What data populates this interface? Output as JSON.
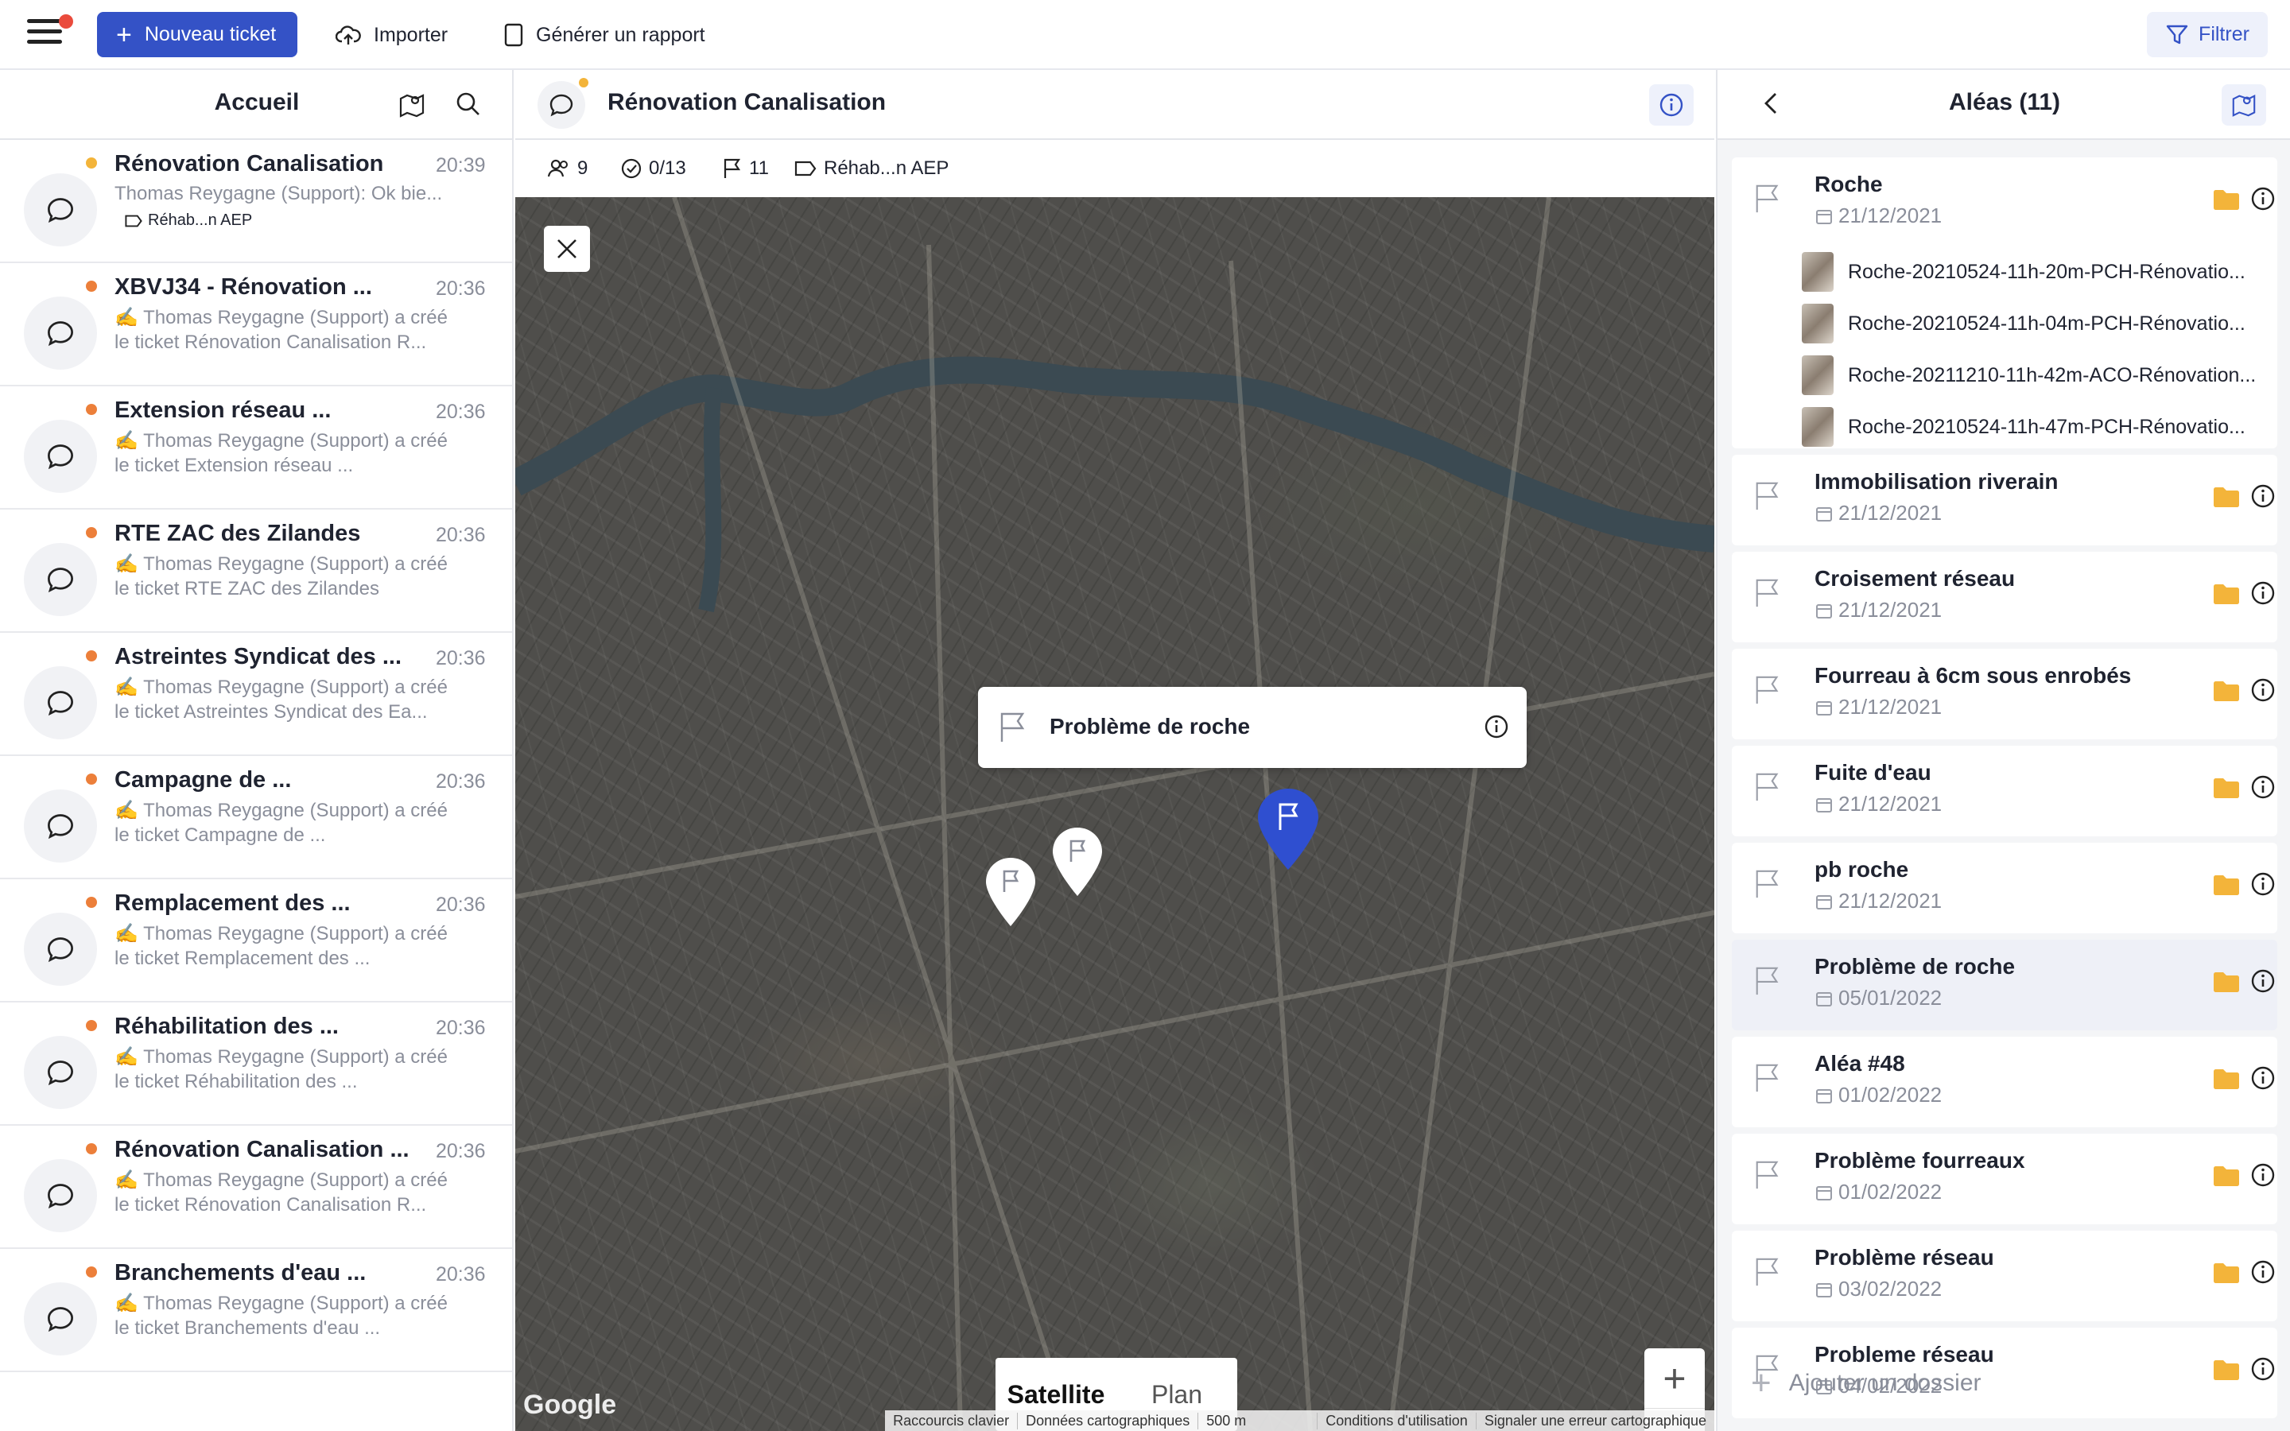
{
  "toolbar": {
    "new_ticket": "Nouveau ticket",
    "import": "Importer",
    "report": "Générer un rapport",
    "filter": "Filtrer"
  },
  "left": {
    "title": "Accueil",
    "tickets": [
      {
        "title": "Rénovation Canalisation",
        "time": "20:39",
        "line1": "Thomas Reygagne (Support): Ok bie...",
        "tag": "Réhab...n AEP"
      },
      {
        "title": "XBVJ34 - Rénovation ...",
        "time": "20:36",
        "line1": "✍️ Thomas Reygagne (Support) a créé",
        "line2": "le ticket Rénovation Canalisation R..."
      },
      {
        "title": "Extension réseau ...",
        "time": "20:36",
        "line1": "✍️ Thomas Reygagne (Support) a créé",
        "line2": "le ticket Extension réseau ..."
      },
      {
        "title": "RTE ZAC des Zilandes",
        "time": "20:36",
        "line1": "✍️ Thomas Reygagne (Support) a créé",
        "line2": "le ticket RTE ZAC des Zilandes"
      },
      {
        "title": "Astreintes Syndicat des ...",
        "time": "20:36",
        "line1": "✍️ Thomas Reygagne (Support) a créé",
        "line2": "le ticket Astreintes Syndicat des Ea..."
      },
      {
        "title": "Campagne de ...",
        "time": "20:36",
        "line1": "✍️ Thomas Reygagne (Support) a créé",
        "line2": "le ticket Campagne de ..."
      },
      {
        "title": "Remplacement des ...",
        "time": "20:36",
        "line1": "✍️ Thomas Reygagne (Support) a créé",
        "line2": "le ticket Remplacement des ..."
      },
      {
        "title": "Réhabilitation des ...",
        "time": "20:36",
        "line1": "✍️ Thomas Reygagne (Support) a créé",
        "line2": "le ticket Réhabilitation des ..."
      },
      {
        "title": "Rénovation Canalisation ...",
        "time": "20:36",
        "line1": "✍️ Thomas Reygagne (Support) a créé",
        "line2": "le ticket Rénovation Canalisation R..."
      },
      {
        "title": "Branchements d'eau ...",
        "time": "20:36",
        "line1": "✍️ Thomas Reygagne (Support) a créé",
        "line2": "le ticket Branchements d'eau ..."
      }
    ]
  },
  "middle": {
    "title": "Rénovation Canalisation",
    "stats": {
      "members": "9",
      "tasks": "0/13",
      "flags": "11",
      "tag": "Réhab...n AEP"
    },
    "popup": "Problème de roche",
    "map_type": {
      "satellite": "Satellite",
      "plan": "Plan"
    },
    "google": "Google",
    "attribution": [
      "Raccourcis clavier",
      "Données cartographiques",
      "500 m",
      "Conditions d'utilisation",
      "Signaler une erreur cartographique"
    ]
  },
  "right": {
    "title": "Aléas (11)",
    "items": [
      {
        "title": "Roche",
        "date": "21/12/2021",
        "files": [
          "Roche-20210524-11h-20m-PCH-Rénovatio...",
          "Roche-20210524-11h-04m-PCH-Rénovatio...",
          "Roche-20211210-11h-42m-ACO-Rénovation...",
          "Roche-20210524-11h-47m-PCH-Rénovatio..."
        ]
      },
      {
        "title": "Immobilisation riverain",
        "date": "21/12/2021"
      },
      {
        "title": "Croisement réseau",
        "date": "21/12/2021"
      },
      {
        "title": "Fourreau à 6cm sous enrobés",
        "date": "21/12/2021"
      },
      {
        "title": "Fuite d'eau",
        "date": "21/12/2021"
      },
      {
        "title": "pb roche",
        "date": "21/12/2021"
      },
      {
        "title": "Problème de roche",
        "date": "05/01/2022"
      },
      {
        "title": "Aléa #48",
        "date": "01/02/2022"
      },
      {
        "title": "Problème fourreaux",
        "date": "01/02/2022"
      },
      {
        "title": "Problème réseau",
        "date": "03/02/2022"
      },
      {
        "title": "Probleme réseau",
        "date": "04/02/2022"
      }
    ],
    "add_folder": "Ajouter un dossier"
  },
  "colors": {
    "primary": "#3452c6",
    "folder": "#f3b43a",
    "unread": "#ec7f3a"
  }
}
